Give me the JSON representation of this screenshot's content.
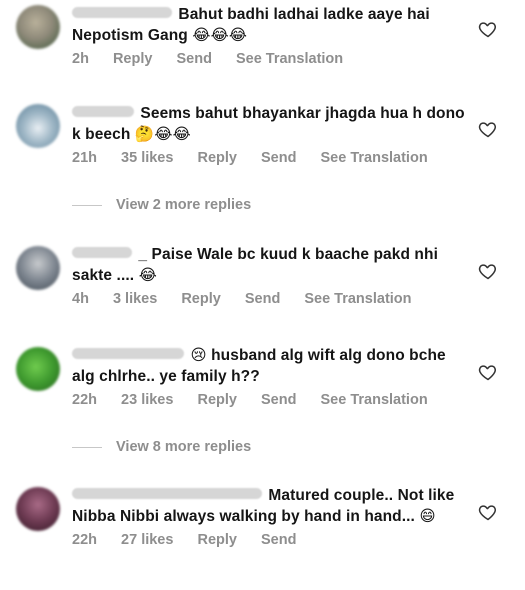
{
  "comments": [
    {
      "text": "Bahut badhi ladhai ladke aaye hai Nepotism Gang",
      "emoji": "😂😂😂",
      "time": "2h",
      "likes": "",
      "reply": "Reply",
      "send": "Send",
      "translate": "See Translation",
      "avatar_color": "#8f8a7a"
    },
    {
      "text": "Seems bahut bhayankar jhagda hua h dono k beech",
      "emoji": "🤔😂😂",
      "time": "21h",
      "likes": "35 likes",
      "reply": "Reply",
      "send": "Send",
      "translate": "See Translation",
      "avatar_color": "#9fb7c6"
    },
    {
      "text": "_ Paise Wale bc kuud k baache pakd nhi sakte ....",
      "emoji": "😂",
      "time": "4h",
      "likes": "3 likes",
      "reply": "Reply",
      "send": "Send",
      "translate": "See Translation",
      "avatar_color": "#7e8690"
    },
    {
      "text": "husband alg wift alg dono bche alg chlrhe.. ye family h??",
      "emoji": "😢",
      "time": "22h",
      "likes": "23 likes",
      "reply": "Reply",
      "send": "Send",
      "translate": "See Translation",
      "avatar_color": "#3f9a2f"
    },
    {
      "text": "Matured couple.. Not like Nibba Nibbi always walking by hand in hand...",
      "emoji": "😄",
      "time": "22h",
      "likes": "27 likes",
      "reply": "Reply",
      "send": "Send",
      "translate": "",
      "avatar_color": "#6d3a52"
    }
  ],
  "view_more": [
    "View 2 more replies",
    "View 8 more replies"
  ],
  "colors": {
    "meta_gray": "#8e8e8e",
    "text": "#151515"
  }
}
